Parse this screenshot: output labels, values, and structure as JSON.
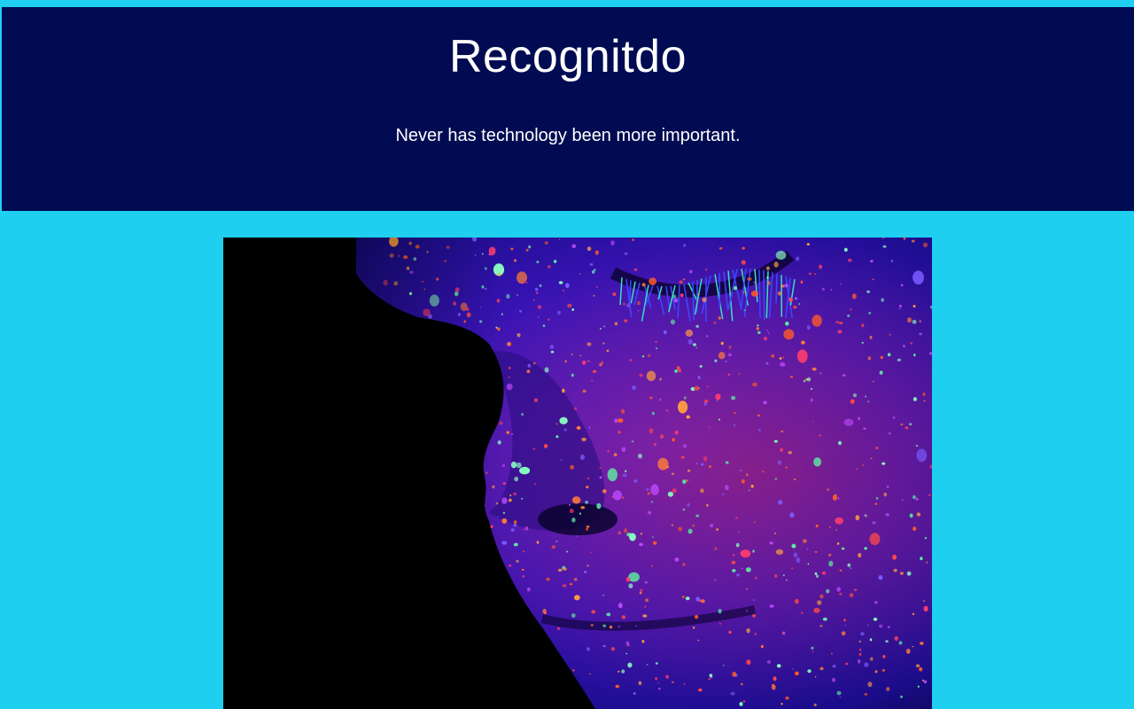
{
  "hero": {
    "title": "Recognitdo",
    "tagline": "Never has technology been more important."
  },
  "image": {
    "subject": "close-up face covered in fluorescent UV paint speckles"
  },
  "colors": {
    "page_background": "#1fcfef",
    "hero_background": "#000b52",
    "hero_text": "#ffffff"
  }
}
